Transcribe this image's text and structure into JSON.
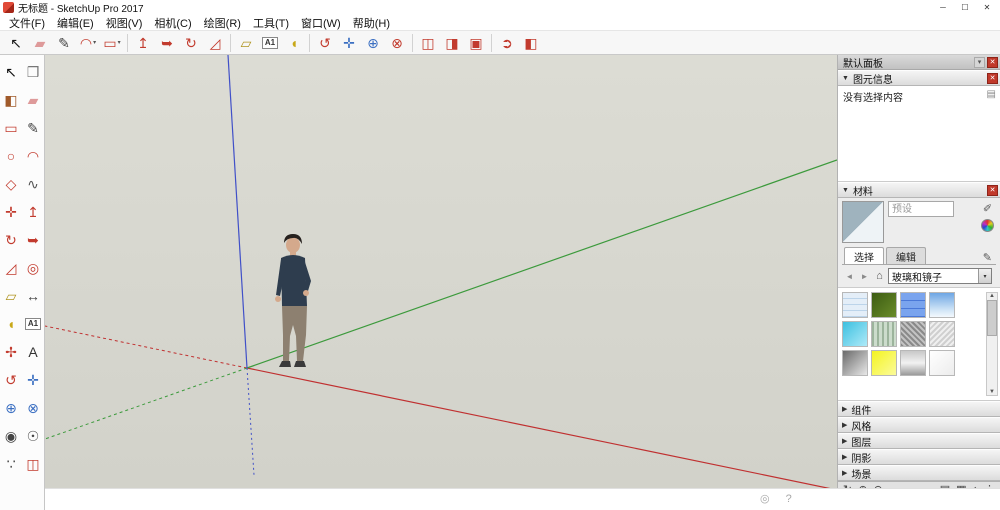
{
  "window": {
    "title": "无标题 - SketchUp Pro 2017",
    "controls": {
      "minimize": "─",
      "maximize": "☐",
      "close": "✕"
    }
  },
  "menu": {
    "items": [
      "文件(F)",
      "编辑(E)",
      "视图(V)",
      "相机(C)",
      "绘图(R)",
      "工具(T)",
      "窗口(W)",
      "帮助(H)"
    ]
  },
  "toolbar": {
    "groups": [
      [
        {
          "name": "select",
          "glyph": "↖",
          "color": "#1a1a1a"
        },
        {
          "name": "eraser",
          "glyph": "▰",
          "color": "#de9a9a"
        },
        {
          "name": "line",
          "glyph": "✎",
          "color": "#444444"
        },
        {
          "name": "arc",
          "glyph": "◠",
          "color": "#c23b2e",
          "dropdown": true
        },
        {
          "name": "shapes",
          "glyph": "▭",
          "color": "#c23b2e",
          "dropdown": true
        }
      ],
      [
        {
          "name": "push-pull",
          "glyph": "↥",
          "color": "#c23b2e"
        },
        {
          "name": "follow-me",
          "glyph": "➥",
          "color": "#c23b2e"
        },
        {
          "name": "rotate",
          "glyph": "↻",
          "color": "#c23b2e"
        },
        {
          "name": "scale",
          "glyph": "◿",
          "color": "#c23b2e"
        }
      ],
      [
        {
          "name": "tape-measure",
          "glyph": "▱",
          "color": "#b09420"
        },
        {
          "name": "text",
          "glyph": "A1",
          "color": "#333333"
        },
        {
          "name": "protractor",
          "glyph": "◖",
          "color": "#c8a818"
        }
      ],
      [
        {
          "name": "orbit",
          "glyph": "↺",
          "color": "#c23b2e"
        },
        {
          "name": "pan",
          "glyph": "✛",
          "color": "#3b6fc2"
        },
        {
          "name": "zoom",
          "glyph": "⊕",
          "color": "#3b6fc2"
        },
        {
          "name": "zoom-extents",
          "glyph": "⊗",
          "color": "#c23b2e"
        }
      ],
      [
        {
          "name": "section-plane",
          "glyph": "◫",
          "color": "#c23b2e"
        },
        {
          "name": "section-display",
          "glyph": "◨",
          "color": "#c23b2e"
        },
        {
          "name": "section-fill",
          "glyph": "▣",
          "color": "#c23b2e"
        }
      ],
      [
        {
          "name": "send-to-layout",
          "glyph": "➲",
          "color": "#c23b2e"
        },
        {
          "name": "paint-bucket",
          "glyph": "◧",
          "color": "#c23b2e"
        }
      ]
    ]
  },
  "left_toolbar": {
    "rows": [
      [
        {
          "name": "lt-select",
          "glyph": "↖",
          "color": "#111111"
        },
        {
          "name": "lt-make-component",
          "glyph": "❒",
          "color": "#777777"
        }
      ],
      [
        {
          "name": "lt-paint-bucket",
          "glyph": "◧",
          "color": "#a05a2a"
        },
        {
          "name": "lt-eraser",
          "glyph": "▰",
          "color": "#de9a9a"
        }
      ],
      [
        {
          "name": "lt-rectangle",
          "glyph": "▭",
          "color": "#c23b2e"
        },
        {
          "name": "lt-line",
          "glyph": "✎",
          "color": "#444444"
        }
      ],
      [
        {
          "name": "lt-circle",
          "glyph": "○",
          "color": "#c23b2e"
        },
        {
          "name": "lt-arc",
          "glyph": "◠",
          "color": "#c23b2e"
        }
      ],
      [
        {
          "name": "lt-polygon",
          "glyph": "◇",
          "color": "#c23b2e"
        },
        {
          "name": "lt-freehand",
          "glyph": "∿",
          "color": "#555555"
        }
      ],
      [
        {
          "name": "lt-move",
          "glyph": "✛",
          "color": "#c23b2e"
        },
        {
          "name": "lt-push-pull",
          "glyph": "↥",
          "color": "#c23b2e"
        }
      ],
      [
        {
          "name": "lt-rotate",
          "glyph": "↻",
          "color": "#c23b2e"
        },
        {
          "name": "lt-follow-me",
          "glyph": "➥",
          "color": "#c23b2e"
        }
      ],
      [
        {
          "name": "lt-scale",
          "glyph": "◿",
          "color": "#c23b2e"
        },
        {
          "name": "lt-offset",
          "glyph": "◎",
          "color": "#c23b2e"
        }
      ],
      [
        {
          "name": "lt-tape-measure",
          "glyph": "▱",
          "color": "#b09420"
        },
        {
          "name": "lt-dimension",
          "glyph": "↔",
          "color": "#444444"
        }
      ],
      [
        {
          "name": "lt-protractor",
          "glyph": "◖",
          "color": "#c8a818"
        },
        {
          "name": "lt-text",
          "glyph": "A1",
          "color": "#333333"
        }
      ],
      [
        {
          "name": "lt-axes",
          "glyph": "✢",
          "color": "#c23b2e"
        },
        {
          "name": "lt-3d-text",
          "glyph": "A",
          "color": "#333333"
        }
      ],
      [
        {
          "name": "lt-orbit",
          "glyph": "↺",
          "color": "#c23b2e"
        },
        {
          "name": "lt-pan",
          "glyph": "✛",
          "color": "#3b6fc2"
        }
      ],
      [
        {
          "name": "lt-zoom",
          "glyph": "⊕",
          "color": "#3b6fc2"
        },
        {
          "name": "lt-zoom-extents",
          "glyph": "⊗",
          "color": "#3b6fc2"
        }
      ],
      [
        {
          "name": "lt-position-camera",
          "glyph": "◉",
          "color": "#444444"
        },
        {
          "name": "lt-look-around",
          "glyph": "☉",
          "color": "#444444"
        }
      ],
      [
        {
          "name": "lt-walk",
          "glyph": "∵",
          "color": "#444444"
        },
        {
          "name": "lt-section-plane",
          "glyph": "◫",
          "color": "#c23b2e"
        }
      ]
    ]
  },
  "right_panel": {
    "title": "默认面板",
    "entity_info": {
      "label": "图元信息",
      "empty_text": "没有选择内容"
    },
    "materials": {
      "label": "材料",
      "name_placeholder": "预设",
      "tabs": [
        {
          "id": "select",
          "label": "选择",
          "active": true
        },
        {
          "id": "edit",
          "label": "编辑",
          "active": false
        }
      ],
      "category": "玻璃和镜子",
      "swatches": [
        {
          "id": "translucent-grid",
          "bg": "repeating-linear-gradient(0deg,#bcd4ea 0 1px,#e4eef8 1px 6px),repeating-linear-gradient(90deg,#bcd4ea 0 1px,rgba(0,0,0,0) 1px 6px)"
        },
        {
          "id": "foliage-green",
          "bg": "linear-gradient(135deg,#3c5c12,#6a8c2a)"
        },
        {
          "id": "window-blue",
          "bg": "repeating-linear-gradient(0deg,#4a78d8 0 1px,#7aa4ee 1px 8px),repeating-linear-gradient(90deg,#4a78d8 0 1px,rgba(0,0,0,0) 1px 8px)"
        },
        {
          "id": "sky-clouds",
          "bg": "linear-gradient(180deg,#6ea6e4,#cfe4f6 70%,#f4f9fd)"
        },
        {
          "id": "cyan-glass",
          "bg": "linear-gradient(135deg,#3cc0e0,#aeeaf8)"
        },
        {
          "id": "green-stripe",
          "bg": "repeating-linear-gradient(90deg,#9cb49c 0 2px,#ccdccc 2px 5px)"
        },
        {
          "id": "frosted-dark",
          "bg": "repeating-linear-gradient(45deg,#8a8a8a 0 2px,#c2c2c2 2px 4px)"
        },
        {
          "id": "frosted-light",
          "bg": "repeating-linear-gradient(-45deg,#cfcfcf 0 2px,#efefef 2px 4px)"
        },
        {
          "id": "mirror-gray",
          "bg": "linear-gradient(135deg,#6a6a6a,#e8e8e8)"
        },
        {
          "id": "yellow-glass",
          "bg": "linear-gradient(135deg,#f4f420,#fbfb9a)"
        },
        {
          "id": "silver",
          "bg": "linear-gradient(180deg,#c8c8c8,#f2f2f2 50%,#9a9a9a)"
        },
        {
          "id": "clear-white",
          "bg": "linear-gradient(135deg,#ffffff,#ececec)"
        }
      ]
    },
    "collapsed": [
      {
        "id": "components",
        "label": "组件"
      },
      {
        "id": "styles",
        "label": "风格"
      },
      {
        "id": "layers",
        "label": "图层"
      },
      {
        "id": "shadows",
        "label": "阴影"
      },
      {
        "id": "scenes",
        "label": "场景"
      }
    ],
    "bottom_tools_left": [
      {
        "name": "update-scene-icon",
        "glyph": "↻"
      },
      {
        "name": "add-scene-icon",
        "glyph": "⊕"
      },
      {
        "name": "remove-scene-icon",
        "glyph": "⊖"
      }
    ],
    "bottom_tools_right": [
      {
        "name": "view-list-icon",
        "glyph": "▤"
      },
      {
        "name": "view-thumbnails-icon",
        "glyph": "▦"
      },
      {
        "name": "move-updown-icon",
        "glyph": "↕"
      },
      {
        "name": "more-options-icon",
        "glyph": "⋮"
      }
    ]
  },
  "statusbar": {
    "icons": [
      {
        "name": "geolocation-icon",
        "glyph": "◎"
      },
      {
        "name": "help-icon",
        "glyph": "?"
      }
    ]
  },
  "ui": {
    "dropdown": "▾",
    "collapsed_arrow": "▶",
    "expanded_arrow": "▼",
    "close": "✕",
    "back": "◄",
    "forward": "►",
    "home": "⌂",
    "scroll_up": "▲",
    "scroll_down": "▼",
    "options": "▾",
    "detail": "▤",
    "brush": "✎",
    "dropper": "✐"
  },
  "colors": {
    "axis_red": "#c03030",
    "axis_green": "#3c9a3c",
    "axis_blue": "#4050c8",
    "accent_red": "#c23b2e",
    "viewport_bg": "#d6d6ce"
  },
  "figure": {
    "shirt": "#2e3d4e",
    "pants": "#8d8070",
    "skin": "#d4a98c",
    "hair": "#26211e",
    "shoes": "#3a3a3a"
  }
}
